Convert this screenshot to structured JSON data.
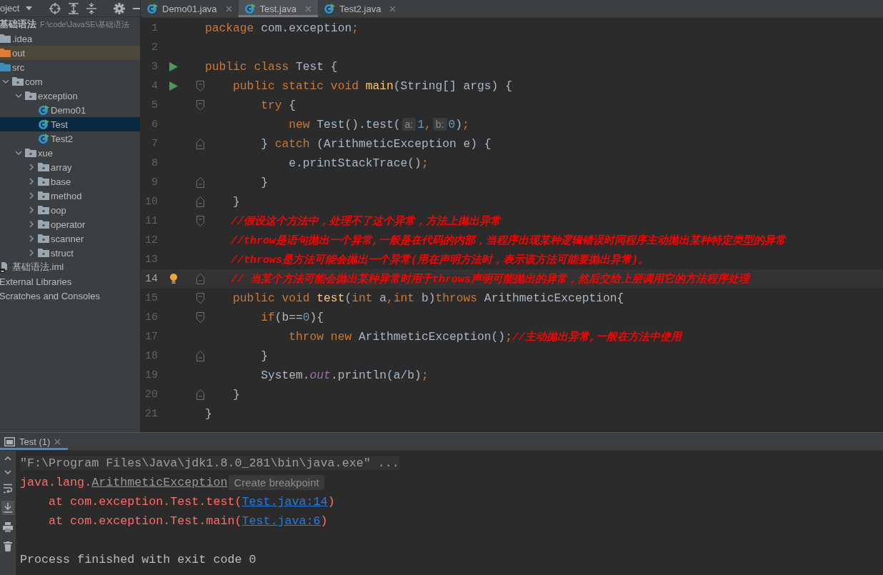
{
  "project_panel": {
    "view_selector": "oject",
    "tree": [
      {
        "label": "基础语法",
        "path": "F:\\code\\JavaSE\\基础语法",
        "kind": "project",
        "selected": false,
        "children": [
          {
            "label": ".idea",
            "kind": "folder",
            "selected": false
          },
          {
            "label": "out",
            "kind": "excluded-folder",
            "selected": false
          },
          {
            "label": "src",
            "kind": "source-folder",
            "selected": false,
            "children": [
              {
                "label": "com",
                "kind": "package",
                "expanded": true,
                "selected": false,
                "children": [
                  {
                    "label": "exception",
                    "kind": "package",
                    "expanded": true,
                    "selected": false,
                    "children": [
                      {
                        "label": "Demo01",
                        "kind": "class",
                        "selected": false
                      },
                      {
                        "label": "Test",
                        "kind": "class",
                        "selected": true
                      },
                      {
                        "label": "Test2",
                        "kind": "class",
                        "selected": false
                      }
                    ]
                  },
                  {
                    "label": "xue",
                    "kind": "package",
                    "expanded": true,
                    "selected": false,
                    "children": [
                      {
                        "label": "array",
                        "kind": "package",
                        "expanded": false,
                        "selected": false
                      },
                      {
                        "label": "base",
                        "kind": "package",
                        "expanded": false,
                        "selected": false
                      },
                      {
                        "label": "method",
                        "kind": "package",
                        "expanded": false,
                        "selected": false
                      },
                      {
                        "label": "oop",
                        "kind": "package",
                        "expanded": false,
                        "selected": false
                      },
                      {
                        "label": "operator",
                        "kind": "package",
                        "expanded": false,
                        "selected": false
                      },
                      {
                        "label": "scanner",
                        "kind": "package",
                        "expanded": false,
                        "selected": false
                      },
                      {
                        "label": "struct",
                        "kind": "package",
                        "expanded": false,
                        "selected": false
                      }
                    ]
                  }
                ]
              }
            ]
          },
          {
            "label": "基础语法.iml",
            "kind": "module-file",
            "selected": false
          }
        ]
      },
      {
        "label": "External Libraries",
        "kind": "library",
        "selected": false
      },
      {
        "label": "Scratches and Consoles",
        "kind": "scratches",
        "selected": false
      }
    ]
  },
  "editor": {
    "tabs": [
      {
        "label": "Demo01.java",
        "selected": false
      },
      {
        "label": "Test.java",
        "selected": true
      },
      {
        "label": "Test2.java",
        "selected": false
      }
    ],
    "lines": [
      {
        "number": "1",
        "current": false,
        "tokens": [
          {
            "kind": "kw",
            "text": "package"
          },
          {
            "kind": "plain",
            "text": " com.exception"
          },
          {
            "kind": "kw",
            "text": ";"
          }
        ]
      },
      {
        "number": "2",
        "current": false
      },
      {
        "number": "3",
        "current": false,
        "gutter_icons": [
          {
            "kind": "run"
          }
        ],
        "tokens": [
          {
            "kind": "kw",
            "text": "public class "
          },
          {
            "kind": "plain",
            "text": "Test {"
          }
        ]
      },
      {
        "number": "4",
        "current": false,
        "gutter_icons": [
          {
            "kind": "run"
          },
          {
            "kind": "fold-start"
          }
        ],
        "tokens": [
          {
            "kind": "kw",
            "text": "    public static void "
          },
          {
            "kind": "fn",
            "text": "main"
          },
          {
            "kind": "plain",
            "text": "(String[] args) {"
          }
        ]
      },
      {
        "number": "5",
        "current": false,
        "gutter_icons": [
          {
            "kind": "fold-start"
          }
        ],
        "tokens": [
          {
            "kind": "kw",
            "text": "        try"
          },
          {
            "kind": "plain",
            "text": " {"
          }
        ]
      },
      {
        "number": "6",
        "current": false,
        "tokens": [
          {
            "kind": "kw",
            "text": "            new "
          },
          {
            "kind": "plain",
            "text": "Test().test("
          },
          {
            "kind": "hint",
            "text": "a:"
          },
          {
            "kind": "num",
            "text": "1"
          },
          {
            "kind": "kw",
            "text": ","
          },
          {
            "kind": "hint",
            "text": "b:"
          },
          {
            "kind": "num",
            "text": "0"
          },
          {
            "kind": "plain",
            "text": ")"
          },
          {
            "kind": "kw",
            "text": ";"
          }
        ]
      },
      {
        "number": "7",
        "current": false,
        "gutter_icons": [
          {
            "kind": "fold-end"
          }
        ],
        "tokens": [
          {
            "kind": "plain",
            "text": "        } "
          },
          {
            "kind": "kw",
            "text": "catch"
          },
          {
            "kind": "plain",
            "text": " (ArithmeticException e) {"
          }
        ]
      },
      {
        "number": "8",
        "current": false,
        "tokens": [
          {
            "kind": "plain",
            "text": "            e.printStackTrace()"
          },
          {
            "kind": "kw",
            "text": ";"
          }
        ]
      },
      {
        "number": "9",
        "current": false,
        "gutter_icons": [
          {
            "kind": "fold-end"
          }
        ],
        "tokens": [
          {
            "kind": "plain",
            "text": "        }"
          }
        ]
      },
      {
        "number": "10",
        "current": false,
        "gutter_icons": [
          {
            "kind": "fold-end"
          }
        ],
        "tokens": [
          {
            "kind": "plain",
            "text": "    }"
          }
        ]
      },
      {
        "number": "11",
        "current": false,
        "gutter_icons": [
          {
            "kind": "fold-start"
          }
        ],
        "tokens": [
          {
            "kind": "comment",
            "text": "    //假设这个方法中，处理不了这个异常，方法上抛出异常"
          }
        ]
      },
      {
        "number": "12",
        "current": false,
        "tokens": [
          {
            "kind": "comment",
            "text": "    //throw是语句抛出一个异常,一般是在代码的内部，当程序出现某种逻辑错误时同程序主动抛出某种特定类型的异常"
          }
        ]
      },
      {
        "number": "13",
        "current": false,
        "tokens": [
          {
            "kind": "comment",
            "text": "    //throws是方法可能会抛出一个异常(用在声明方法时，表示该方法可能要抛出异常)。"
          }
        ]
      },
      {
        "number": "14",
        "current": true,
        "gutter_icons": [
          {
            "kind": "bulb"
          },
          {
            "kind": "fold-end"
          }
        ],
        "tokens": [
          {
            "kind": "comment",
            "text": "    // 当某个方法可能会抛出某种异常时用于throws声明可能抛出的异常，然后交给上层调用它的方法程序处理"
          }
        ]
      },
      {
        "number": "15",
        "current": false,
        "gutter_icons": [
          {
            "kind": "fold-start"
          }
        ],
        "tokens": [
          {
            "kind": "kw",
            "text": "    public void "
          },
          {
            "kind": "fn",
            "text": "test"
          },
          {
            "kind": "plain",
            "text": "("
          },
          {
            "kind": "kw",
            "text": "int"
          },
          {
            "kind": "plain",
            "text": " a"
          },
          {
            "kind": "kw",
            "text": ",int"
          },
          {
            "kind": "plain",
            "text": " b)"
          },
          {
            "kind": "kw",
            "text": "throws"
          },
          {
            "kind": "plain",
            "text": " ArithmeticException{"
          }
        ]
      },
      {
        "number": "16",
        "current": false,
        "gutter_icons": [
          {
            "kind": "fold-start"
          }
        ],
        "tokens": [
          {
            "kind": "kw",
            "text": "        if"
          },
          {
            "kind": "plain",
            "text": "(b=="
          },
          {
            "kind": "num",
            "text": "0"
          },
          {
            "kind": "plain",
            "text": "){"
          }
        ]
      },
      {
        "number": "17",
        "current": false,
        "tokens": [
          {
            "kind": "kw",
            "text": "            throw new "
          },
          {
            "kind": "plain",
            "text": "ArithmeticException()"
          },
          {
            "kind": "kw",
            "text": ";"
          },
          {
            "kind": "comment",
            "text": "//主动抛出异常,一般在方法中使用"
          }
        ]
      },
      {
        "number": "18",
        "current": false,
        "gutter_icons": [
          {
            "kind": "fold-end"
          }
        ],
        "tokens": [
          {
            "kind": "plain",
            "text": "        }"
          }
        ]
      },
      {
        "number": "19",
        "current": false,
        "tokens": [
          {
            "kind": "plain",
            "text": "        System."
          },
          {
            "kind": "field",
            "text": "out"
          },
          {
            "kind": "plain",
            "text": ".println(a/b)"
          },
          {
            "kind": "kw",
            "text": ";"
          }
        ]
      },
      {
        "number": "20",
        "current": false,
        "gutter_icons": [
          {
            "kind": "fold-end"
          }
        ],
        "tokens": [
          {
            "kind": "plain",
            "text": "    }"
          }
        ]
      },
      {
        "number": "21",
        "current": false,
        "tokens": [
          {
            "kind": "plain",
            "text": "}"
          }
        ]
      }
    ]
  },
  "run_panel": {
    "tabs": [
      {
        "label": "Test (1)",
        "selected": true
      }
    ],
    "lines": [
      {
        "kind": "command",
        "segments": [
          {
            "kind": "command",
            "text": "\"F:\\Program Files\\Java\\jdk1.8.0_281\\bin\\java.exe\" ..."
          }
        ]
      },
      {
        "kind": "text",
        "hint": "Create breakpoint",
        "segments": [
          {
            "kind": "error",
            "text": "java.lang."
          },
          {
            "kind": "class-ref",
            "text": "ArithmeticException"
          }
        ]
      },
      {
        "kind": "text",
        "segments": [
          {
            "kind": "error",
            "text": "    at com.exception.Test.test("
          },
          {
            "kind": "link",
            "text": "Test.java:14"
          },
          {
            "kind": "error",
            "text": ")"
          }
        ]
      },
      {
        "kind": "text",
        "segments": [
          {
            "kind": "error",
            "text": "    at com.exception.Test.main("
          },
          {
            "kind": "link",
            "text": "Test.java:6"
          },
          {
            "kind": "error",
            "text": ")"
          }
        ]
      },
      {
        "kind": "blank"
      },
      {
        "kind": "text",
        "segments": [
          {
            "kind": "output",
            "text": "Process finished with exit code 0"
          }
        ]
      },
      {
        "kind": "caret"
      }
    ]
  }
}
